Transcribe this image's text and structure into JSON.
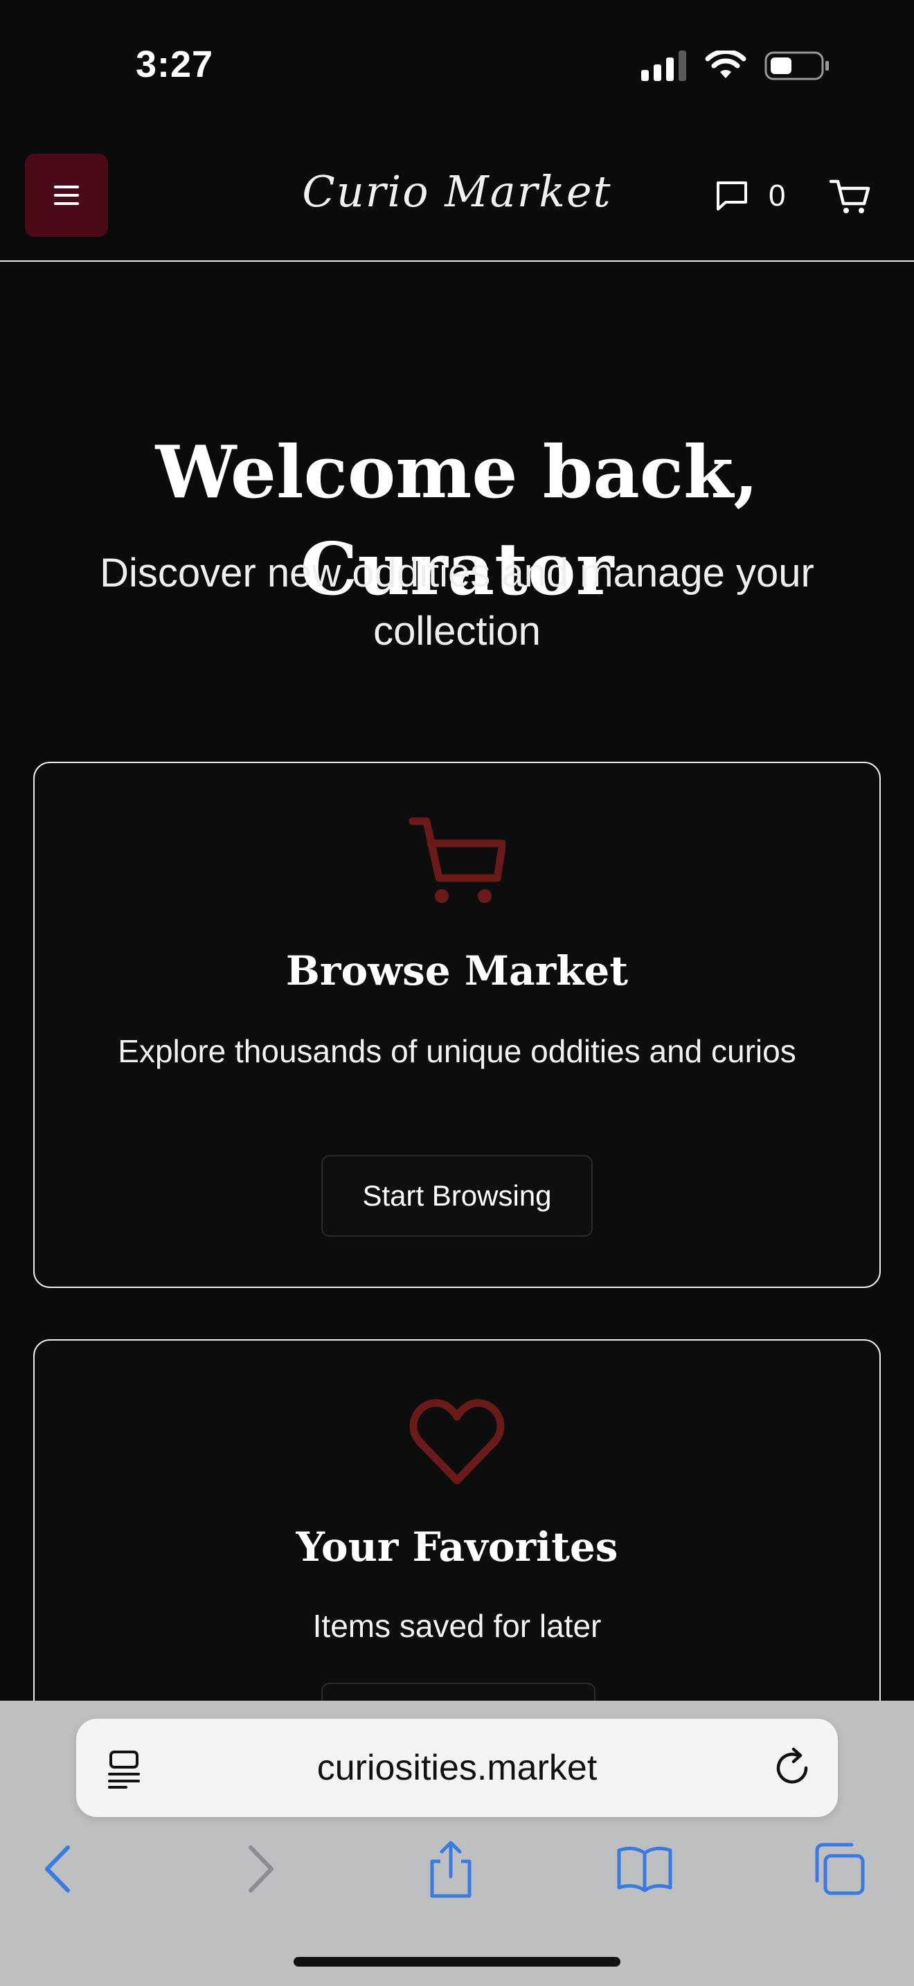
{
  "status_bar": {
    "time": "3:27",
    "icons": [
      "cellular-signal-icon",
      "wifi-icon",
      "battery-icon"
    ]
  },
  "header": {
    "menu_icon": "hamburger-icon",
    "logo": "Curio Market",
    "messages_icon": "chat-bubble-icon",
    "messages_count": "0",
    "cart_icon": "cart-icon"
  },
  "hero": {
    "title": "Welcome back, Curator",
    "subtitle": "Discover new oddities and manage your collection"
  },
  "cards": [
    {
      "icon": "cart-icon",
      "title": "Browse Market",
      "description": "Explore thousands of unique oddities and curios",
      "button": "Start Browsing"
    },
    {
      "icon": "heart-icon",
      "title": "Your Favorites",
      "description": "Items saved for later"
    }
  ],
  "browser": {
    "url": "curiosities.market",
    "toolbar": [
      "back-icon",
      "forward-icon",
      "share-icon",
      "bookmarks-icon",
      "tabs-icon"
    ]
  },
  "colors": {
    "background": "#0b0b0b",
    "accent": "#4a0a16",
    "icon_red": "#6b1a1a",
    "browser_blue": "#3a7be0"
  }
}
